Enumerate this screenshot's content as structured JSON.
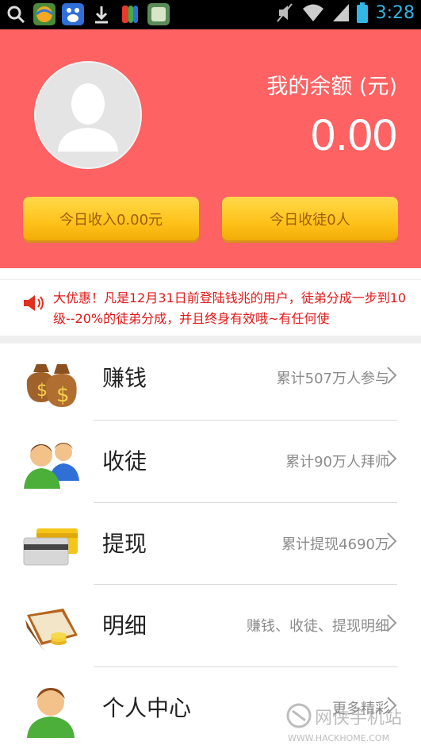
{
  "status_bar": {
    "time": "3:28",
    "left_icons": [
      "search-icon",
      "app-icon-ball",
      "baidu-icon",
      "download-icon",
      "app-icon-flag",
      "app-icon-card"
    ],
    "right_icons": [
      "mute-icon",
      "wifi-icon",
      "signal-icon",
      "battery-icon"
    ]
  },
  "header": {
    "balance_label": "我的余额 (元)",
    "balance_value": "0.00",
    "today_income": "今日收入0.00元",
    "today_apprentices": "今日收徒0人",
    "background_color": "#fe6263",
    "button_color": "#ffc926"
  },
  "notice": {
    "icon": "speaker-icon",
    "text": "大优惠！凡是12月31日前登陆钱兆的用户，徒弟分成一步到10级--20%的徒弟分成，并且终身有效哦~有任何使"
  },
  "menu": [
    {
      "icon": "money-bag-icon",
      "title": "赚钱",
      "subtitle": "累计507万人参与"
    },
    {
      "icon": "people-icon",
      "title": "收徒",
      "subtitle": "累计90万人拜师"
    },
    {
      "icon": "card-icon",
      "title": "提现",
      "subtitle": "累计提现4690万"
    },
    {
      "icon": "wallet-icon",
      "title": "明细",
      "subtitle": "赚钱、收徒、提现明细"
    },
    {
      "icon": "person-icon",
      "title": "个人中心",
      "subtitle": "更多精彩"
    }
  ],
  "watermark": {
    "brand": "网侠手机站",
    "url": "WWW.HACKHOME.COM"
  }
}
